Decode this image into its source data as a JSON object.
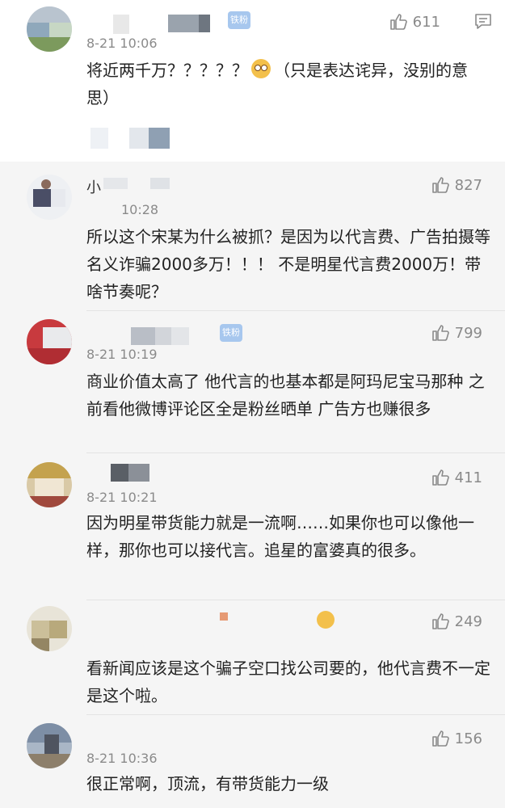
{
  "comments": [
    {
      "username": "",
      "badge": "铁粉",
      "time": "8-21 10:06",
      "text_pre": "将近两千万？？？？？",
      "emoji": "flushed-face",
      "text_post": "（只是表达诧异，没别的意思）",
      "likes": "611"
    },
    {
      "username": "小",
      "time": "10:28",
      "text": "所以这个宋某为什么被抓？是因为以代言费、广告拍摄等名义诈骗2000多万！！！ 不是明星代言费2000万！带啥节奏呢？",
      "likes": "827"
    },
    {
      "badge": "铁粉",
      "time": "8-21 10:19",
      "text": "商业价值太高了 他代言的也基本都是阿玛尼宝马那种 之前看他微博评论区全是粉丝晒单 广告方也赚很多",
      "likes": "799"
    },
    {
      "time": "8-21 10:21",
      "text": "因为明星带货能力就是一流啊……如果你也可以像他一样，那你也可以接代言。追星的富婆真的很多。",
      "likes": "411"
    },
    {
      "text": "看新闻应该是这个骗子空口找公司要的，他代言费不一定是这个啦。",
      "likes": "249"
    },
    {
      "time": "8-21 10:36",
      "text": "很正常啊，顶流，有带货能力一级",
      "likes": "156"
    }
  ],
  "colors": {
    "first_bg": "#ffffff",
    "page_bg": "#f5f5f5",
    "text": "#222222",
    "meta": "#8a8a8a",
    "badge": "#a7c7ee"
  }
}
